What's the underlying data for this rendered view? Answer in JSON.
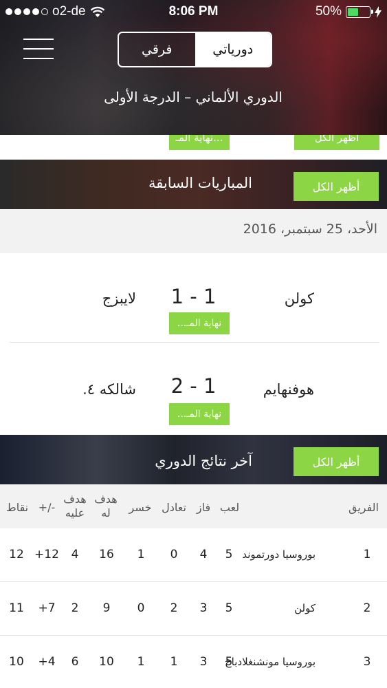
{
  "status_bar": {
    "carrier": "o2-de",
    "time": "8:06 PM",
    "battery": "50%",
    "battery_level": 0.5,
    "icons": [
      "signal-dots-icon",
      "wifi-icon",
      "battery-icon",
      "charging-bolt-icon"
    ]
  },
  "nav": {
    "menu_icon": "hamburger-menu-icon",
    "tabs": [
      {
        "label": "فرقي",
        "selected": false
      },
      {
        "label": "دورياتي",
        "selected": true
      }
    ],
    "league_title": "الدوري الألماني – الدرجة الأولى"
  },
  "strip": {
    "show_all_cut": "أظهر الكل",
    "badge_cut": "نهاية المـ..."
  },
  "previous_matches": {
    "title": "المباريات السابقة",
    "show_all": "أظهر الكل",
    "date": "الأحد، 25 سبتمبر، 2016",
    "matches": [
      {
        "home": "كولن",
        "score": "1 - 1",
        "away": "لايبزج",
        "status": "نهاية المـ..."
      },
      {
        "home": "هوفنهايم",
        "score": "2 - 1",
        "away": "شالكه ٤.",
        "status": "نهاية المـ..."
      }
    ]
  },
  "standings": {
    "title": "آخر نتائج الدوري",
    "show_all": "أظهر الكل",
    "headers": {
      "team": "الفريق",
      "played": "لعب",
      "won": "فاز",
      "drawn": "تعادل",
      "lost": "خسر",
      "goals_for": "هدف له",
      "goals_against": "هدف عليه",
      "goal_diff": "+/-",
      "points": "نقاط"
    },
    "rows": [
      {
        "rank": "1",
        "team": "بوروسيا دورتموند",
        "played": "5",
        "won": "4",
        "drawn": "0",
        "lost": "1",
        "gf": "16",
        "ga": "4",
        "gd": "+12",
        "pts": "12"
      },
      {
        "rank": "2",
        "team": "كولن",
        "played": "5",
        "won": "3",
        "drawn": "2",
        "lost": "0",
        "gf": "9",
        "ga": "2",
        "gd": "+7",
        "pts": "11"
      },
      {
        "rank": "3",
        "team": "بوروسيا مونشنغلادباخ",
        "played": "5",
        "won": "3",
        "drawn": "1",
        "lost": "1",
        "gf": "10",
        "ga": "6",
        "gd": "+4",
        "pts": "10"
      }
    ]
  },
  "colors": {
    "accent_green": "#8cd645",
    "battery_green": "#4cd964",
    "header_dark": "#1d1d22"
  }
}
